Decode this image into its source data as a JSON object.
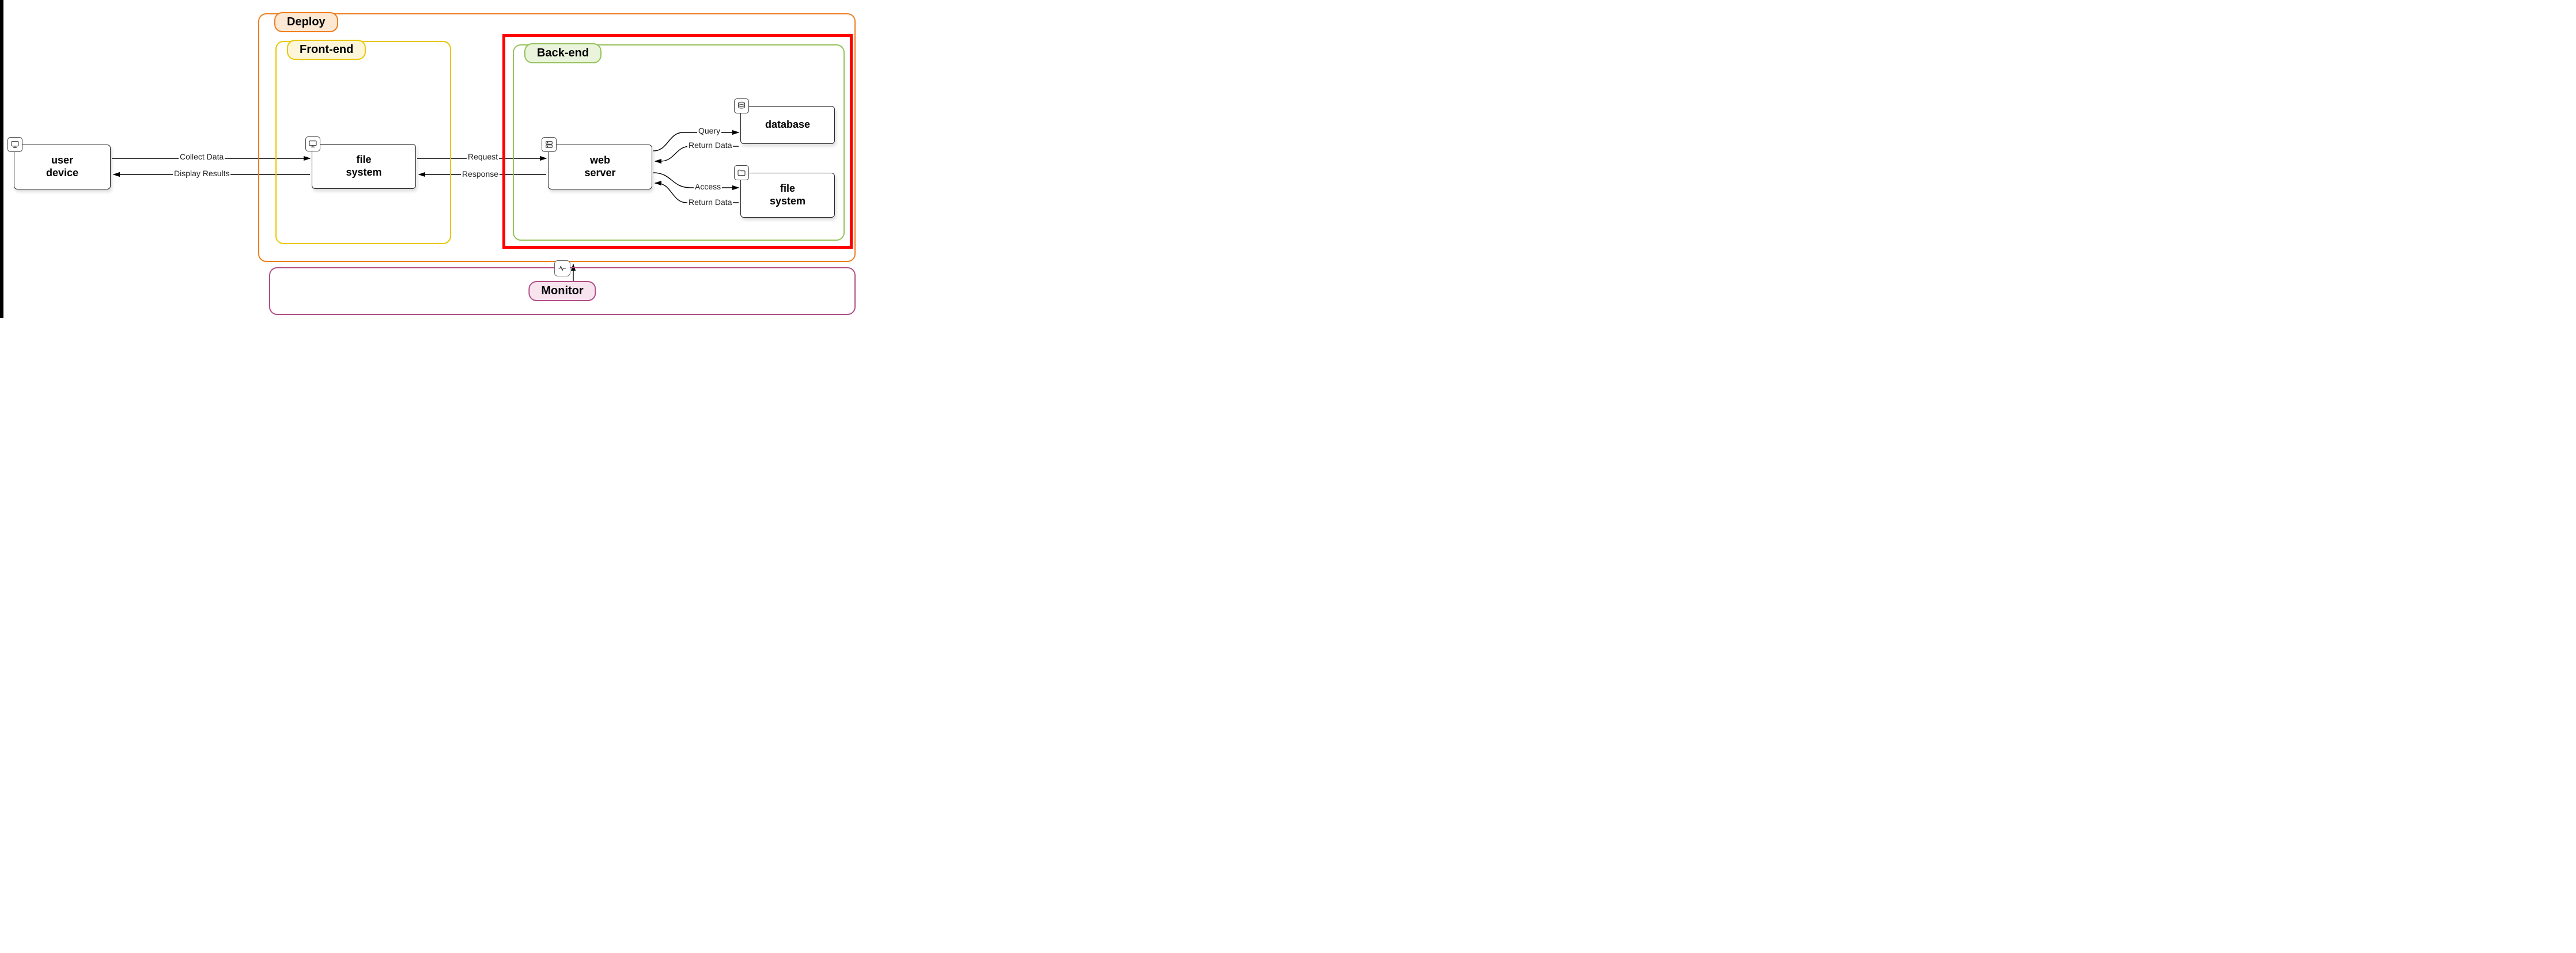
{
  "groups": {
    "deploy": {
      "label": "Deploy"
    },
    "frontend": {
      "label": "Front-end"
    },
    "backend": {
      "label": "Back-end"
    },
    "monitor": {
      "label": "Monitor"
    }
  },
  "nodes": {
    "user_device": {
      "line1": "user",
      "line2": "device",
      "icon": "monitor"
    },
    "file_system": {
      "line1": "file",
      "line2": "system",
      "icon": "monitor"
    },
    "web_server": {
      "line1": "web",
      "line2": "server",
      "icon": "server"
    },
    "database": {
      "line1": "database",
      "line2": "",
      "icon": "database"
    },
    "file_system2": {
      "line1": "file",
      "line2": "system",
      "icon": "folder"
    }
  },
  "edges": {
    "collect_data": "Collect Data",
    "display_results": "Display Results",
    "request": "Request",
    "response": "Response",
    "query": "Query",
    "return_data_db": "Return Data",
    "access": "Access",
    "return_data_fs": "Return Data"
  },
  "highlight": {
    "target": "backend",
    "color": "#ff0000"
  }
}
